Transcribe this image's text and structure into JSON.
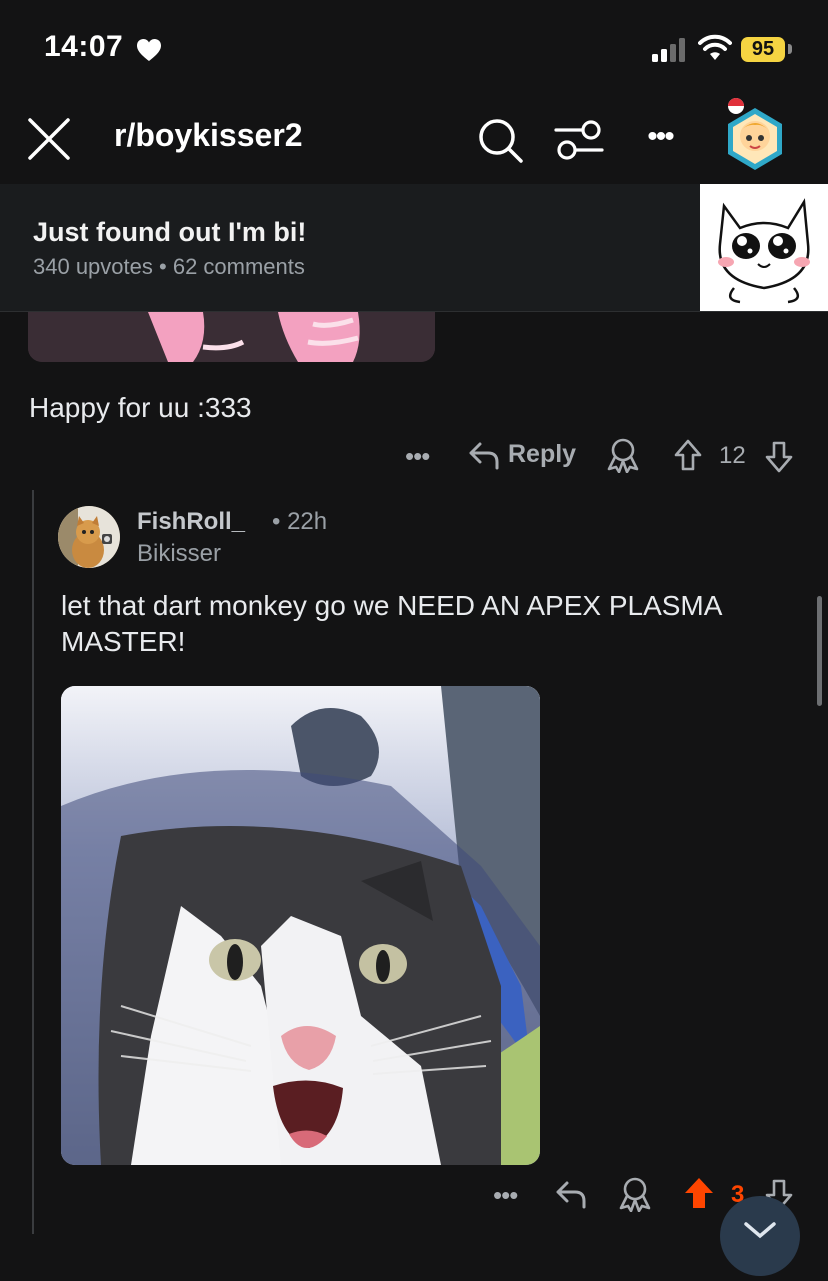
{
  "status_bar": {
    "time": "14:07",
    "battery": "95"
  },
  "header": {
    "subreddit": "r/boykisser2"
  },
  "post": {
    "title": "Just found out I'm bi!",
    "upvotes": "340 upvotes",
    "separator": "•",
    "comments": "62 comments"
  },
  "previous_comment": {
    "body": "Happy for uu :333",
    "actions": {
      "more": "•••",
      "reply": "Reply",
      "score": "12"
    }
  },
  "comment": {
    "author": "FishRoll_",
    "time": "• 22h",
    "flair": "Bikisser",
    "body": "let that dart monkey go we NEED AN APEX PLASMA MASTER!",
    "actions": {
      "more": "•••",
      "score": "3"
    }
  },
  "colors": {
    "background": "#131314",
    "upvote_active": "#ff4500",
    "battery": "#f5d442"
  }
}
